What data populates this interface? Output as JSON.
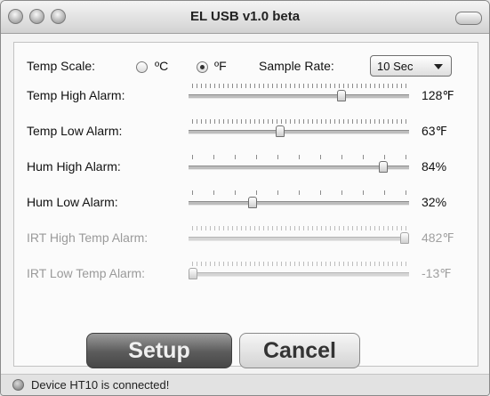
{
  "window": {
    "title": "EL USB v1.0 beta"
  },
  "temp_scale": {
    "label": "Temp Scale:",
    "celsius_label": "ºC",
    "fahrenheit_label": "ºF",
    "selected": "F"
  },
  "sample_rate": {
    "label": "Sample Rate:",
    "value": "10 Sec"
  },
  "sliders": [
    {
      "label": "Temp High Alarm:",
      "value_text": "128℉",
      "position": 0.7,
      "enabled": true,
      "ticks": "fine"
    },
    {
      "label": "Temp Low Alarm:",
      "value_text": "63℉",
      "position": 0.41,
      "enabled": true,
      "ticks": "fine"
    },
    {
      "label": "Hum High Alarm:",
      "value_text": "84%",
      "position": 0.9,
      "enabled": true,
      "ticks": "coarse"
    },
    {
      "label": "Hum Low Alarm:",
      "value_text": "32%",
      "position": 0.28,
      "enabled": true,
      "ticks": "coarse"
    },
    {
      "label": "IRT High Temp Alarm:",
      "value_text": "482℉",
      "position": 1.0,
      "enabled": false,
      "ticks": "fine"
    },
    {
      "label": "IRT Low Temp Alarm:",
      "value_text": "-13℉",
      "position": 0.0,
      "enabled": false,
      "ticks": "fine"
    }
  ],
  "buttons": {
    "setup": "Setup",
    "cancel": "Cancel"
  },
  "status": {
    "text": "Device HT10 is connected!"
  }
}
